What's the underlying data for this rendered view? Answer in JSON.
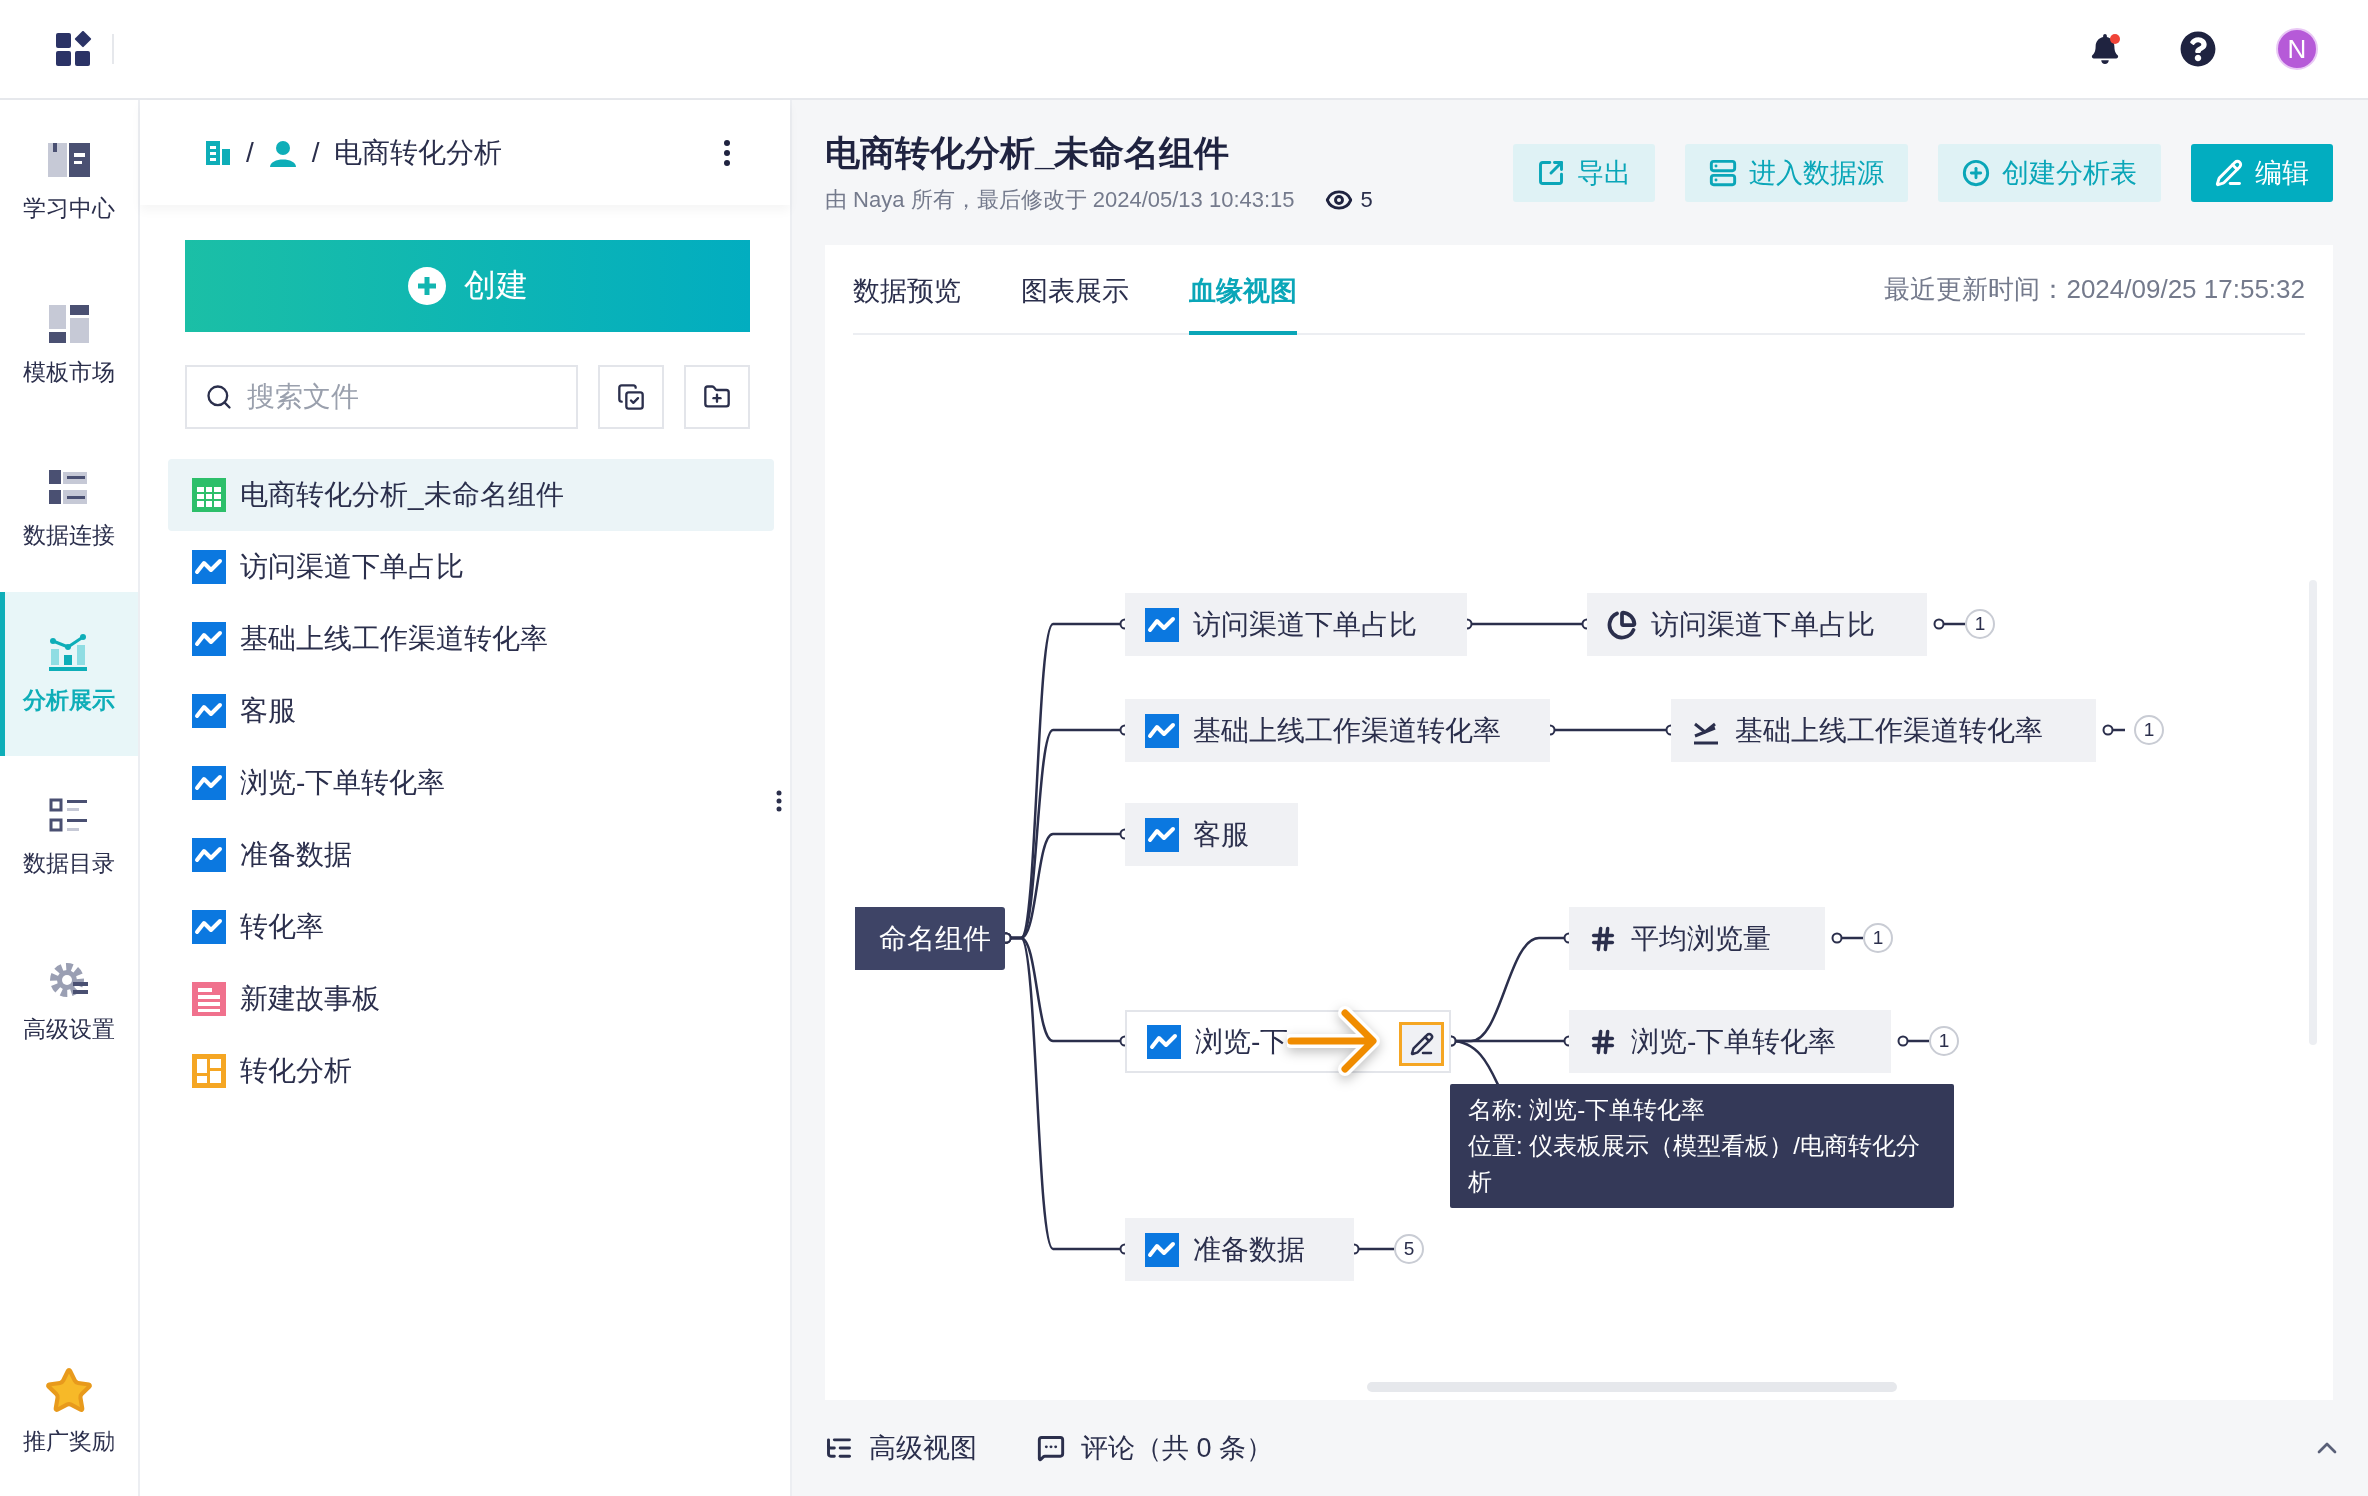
{
  "top_bar": {
    "avatar": "N",
    "has_notification": true
  },
  "nav": [
    {
      "label": "学习中心",
      "kind": "learn",
      "selected": false
    },
    {
      "label": "模板市场",
      "kind": "template",
      "selected": false
    },
    {
      "label": "数据连接",
      "kind": "connect",
      "selected": false
    },
    {
      "label": "分析展示",
      "kind": "analysis",
      "selected": true
    },
    {
      "label": "数据目录",
      "kind": "catalog",
      "selected": false
    },
    {
      "label": "高级设置",
      "kind": "settings",
      "selected": false
    }
  ],
  "nav_bottom": {
    "label": "推广奖励"
  },
  "breadcrumb": [
    {
      "kind": "org"
    },
    {
      "kind": "user",
      "separator": "/"
    },
    {
      "label": "电商转化分析",
      "separator": "/"
    }
  ],
  "create_button": "创建",
  "search": {
    "placeholder": "搜索文件"
  },
  "files": [
    {
      "label": "电商转化分析_未命名组件",
      "kind": "table",
      "selected": true
    },
    {
      "label": "访问渠道下单占比",
      "kind": "chart",
      "selected": false
    },
    {
      "label": "基础上线工作渠道转化率",
      "kind": "chart",
      "selected": false
    },
    {
      "label": "客服",
      "kind": "chart",
      "selected": false
    },
    {
      "label": "浏览-下单转化率",
      "kind": "chart",
      "selected": false
    },
    {
      "label": "准备数据",
      "kind": "chart",
      "selected": false
    },
    {
      "label": "转化率",
      "kind": "chart",
      "selected": false
    },
    {
      "label": "新建故事板",
      "kind": "story",
      "selected": false
    },
    {
      "label": "转化分析",
      "kind": "dashboard",
      "selected": false
    }
  ],
  "header": {
    "title": "电商转化分析_未命名组件",
    "meta": "由 Naya 所有，最后修改于 2024/05/13 10:43:15",
    "views": "5"
  },
  "actions": [
    {
      "label": "导出",
      "kind": "export",
      "primary": false
    },
    {
      "label": "进入数据源",
      "kind": "source",
      "primary": false
    },
    {
      "label": "创建分析表",
      "kind": "create",
      "primary": false
    },
    {
      "label": "编辑",
      "kind": "edit",
      "primary": true
    }
  ],
  "tabs": [
    {
      "label": "数据预览",
      "selected": false
    },
    {
      "label": "图表展示",
      "selected": false
    },
    {
      "label": "血缘视图",
      "selected": true
    }
  ],
  "updated": "最近更新时间：2024/09/25 17:55:32",
  "lineage": {
    "root": "命名组件",
    "nodes": [
      {
        "label": "访问渠道下单占比",
        "kind": "chart",
        "children": [
          {
            "label": "访问渠道下单占比",
            "kind": "pie",
            "count": "1"
          }
        ]
      },
      {
        "label": "基础上线工作渠道转化率",
        "kind": "chart",
        "children": [
          {
            "label": "基础上线工作渠道转化率",
            "kind": "cross",
            "count": "1"
          }
        ]
      },
      {
        "label": "客服",
        "kind": "chart"
      },
      {
        "label": "浏览-下",
        "kind": "chart",
        "hovered": true,
        "children": [
          {
            "label": "平均浏览量",
            "kind": "number",
            "count": "1"
          },
          {
            "label": "浏览-下单转化率",
            "kind": "number",
            "count": "1"
          }
        ]
      },
      {
        "label": "准备数据",
        "kind": "chart",
        "count": "5"
      }
    ]
  },
  "tooltip": {
    "lines": [
      "名称: 浏览-下单转化率",
      "位置: 仪表板展示（模型看板）/电商转化分析"
    ]
  },
  "footer": [
    {
      "label": "高级视图",
      "kind": "advanced"
    },
    {
      "label": "评论（共 0 条）",
      "kind": "comment"
    }
  ]
}
